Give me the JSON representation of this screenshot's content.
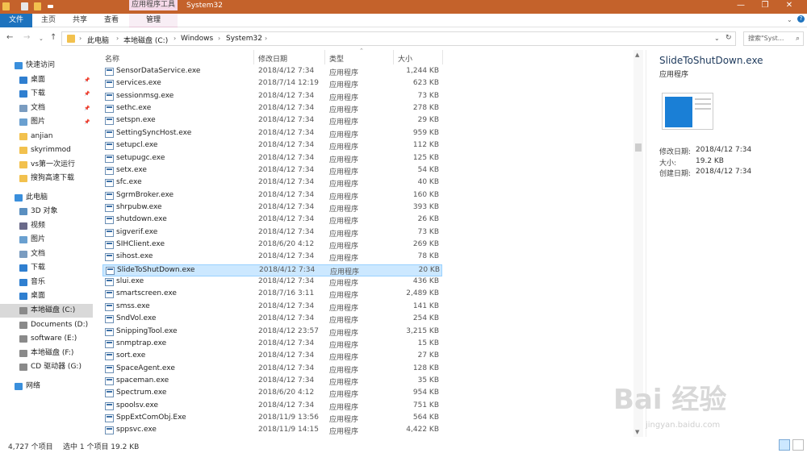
{
  "window": {
    "contextual_tab": "应用程序工具",
    "title": "System32"
  },
  "ribbon": {
    "tabs": [
      "文件",
      "主页",
      "共享",
      "查看",
      "管理"
    ]
  },
  "address": {
    "segments": [
      "此电脑",
      "本地磁盘 (C:)",
      "Windows",
      "System32"
    ],
    "search_placeholder": "搜索\"Syst..."
  },
  "sidebar": {
    "items": [
      {
        "label": "快速访问",
        "icon": "star-icon",
        "pinned": false
      },
      {
        "label": "桌面",
        "icon": "desktop-icon",
        "pinned": true
      },
      {
        "label": "下载",
        "icon": "download-icon",
        "pinned": true
      },
      {
        "label": "文档",
        "icon": "document-icon",
        "pinned": true
      },
      {
        "label": "图片",
        "icon": "picture-icon",
        "pinned": true
      },
      {
        "label": "anjian",
        "icon": "folder-icon",
        "pinned": false
      },
      {
        "label": "skyrimmod",
        "icon": "folder-icon",
        "pinned": false
      },
      {
        "label": "vs第一次运行",
        "icon": "folder-icon",
        "pinned": false
      },
      {
        "label": "搜狗高速下载",
        "icon": "folder-icon",
        "pinned": false
      },
      {
        "label": "此电脑",
        "icon": "computer-icon",
        "pinned": false
      },
      {
        "label": "3D 对象",
        "icon": "cube-icon",
        "pinned": false
      },
      {
        "label": "视频",
        "icon": "video-icon",
        "pinned": false
      },
      {
        "label": "图片",
        "icon": "picture-icon",
        "pinned": false
      },
      {
        "label": "文档",
        "icon": "document-icon",
        "pinned": false
      },
      {
        "label": "下载",
        "icon": "download-icon",
        "pinned": false
      },
      {
        "label": "音乐",
        "icon": "music-icon",
        "pinned": false
      },
      {
        "label": "桌面",
        "icon": "desktop-icon",
        "pinned": false
      },
      {
        "label": "本地磁盘 (C:)",
        "icon": "drive-icon",
        "pinned": false
      },
      {
        "label": "Documents (D:)",
        "icon": "drive-icon",
        "pinned": false
      },
      {
        "label": "software (E:)",
        "icon": "drive-icon",
        "pinned": false
      },
      {
        "label": "本地磁盘 (F:)",
        "icon": "drive-icon",
        "pinned": false
      },
      {
        "label": "CD 驱动器 (G:)",
        "icon": "cd-drive-icon",
        "pinned": false
      },
      {
        "label": "网络",
        "icon": "network-icon",
        "pinned": false
      }
    ],
    "pin_glyph": "📌"
  },
  "columns": [
    "名称",
    "修改日期",
    "类型",
    "大小"
  ],
  "files": [
    {
      "name": "SensorDataService.exe",
      "date": "2018/4/12 7:34",
      "type": "应用程序",
      "size": "1,244 KB"
    },
    {
      "name": "services.exe",
      "date": "2018/7/14 12:19",
      "type": "应用程序",
      "size": "623 KB"
    },
    {
      "name": "sessionmsg.exe",
      "date": "2018/4/12 7:34",
      "type": "应用程序",
      "size": "73 KB"
    },
    {
      "name": "sethc.exe",
      "date": "2018/4/12 7:34",
      "type": "应用程序",
      "size": "278 KB"
    },
    {
      "name": "setspn.exe",
      "date": "2018/4/12 7:34",
      "type": "应用程序",
      "size": "29 KB"
    },
    {
      "name": "SettingSyncHost.exe",
      "date": "2018/4/12 7:34",
      "type": "应用程序",
      "size": "959 KB"
    },
    {
      "name": "setupcl.exe",
      "date": "2018/4/12 7:34",
      "type": "应用程序",
      "size": "112 KB"
    },
    {
      "name": "setupugc.exe",
      "date": "2018/4/12 7:34",
      "type": "应用程序",
      "size": "125 KB"
    },
    {
      "name": "setx.exe",
      "date": "2018/4/12 7:34",
      "type": "应用程序",
      "size": "54 KB"
    },
    {
      "name": "sfc.exe",
      "date": "2018/4/12 7:34",
      "type": "应用程序",
      "size": "40 KB"
    },
    {
      "name": "SgrmBroker.exe",
      "date": "2018/4/12 7:34",
      "type": "应用程序",
      "size": "160 KB"
    },
    {
      "name": "shrpubw.exe",
      "date": "2018/4/12 7:34",
      "type": "应用程序",
      "size": "393 KB"
    },
    {
      "name": "shutdown.exe",
      "date": "2018/4/12 7:34",
      "type": "应用程序",
      "size": "26 KB"
    },
    {
      "name": "sigverif.exe",
      "date": "2018/4/12 7:34",
      "type": "应用程序",
      "size": "73 KB"
    },
    {
      "name": "SIHClient.exe",
      "date": "2018/6/20 4:12",
      "type": "应用程序",
      "size": "269 KB"
    },
    {
      "name": "sihost.exe",
      "date": "2018/4/12 7:34",
      "type": "应用程序",
      "size": "78 KB"
    },
    {
      "name": "SlideToShutDown.exe",
      "date": "2018/4/12 7:34",
      "type": "应用程序",
      "size": "20 KB",
      "selected": true
    },
    {
      "name": "slui.exe",
      "date": "2018/4/12 7:34",
      "type": "应用程序",
      "size": "436 KB"
    },
    {
      "name": "smartscreen.exe",
      "date": "2018/7/16 3:11",
      "type": "应用程序",
      "size": "2,489 KB"
    },
    {
      "name": "smss.exe",
      "date": "2018/4/12 7:34",
      "type": "应用程序",
      "size": "141 KB"
    },
    {
      "name": "SndVol.exe",
      "date": "2018/4/12 7:34",
      "type": "应用程序",
      "size": "254 KB"
    },
    {
      "name": "SnippingTool.exe",
      "date": "2018/4/12 23:57",
      "type": "应用程序",
      "size": "3,215 KB"
    },
    {
      "name": "snmptrap.exe",
      "date": "2018/4/12 7:34",
      "type": "应用程序",
      "size": "15 KB"
    },
    {
      "name": "sort.exe",
      "date": "2018/4/12 7:34",
      "type": "应用程序",
      "size": "27 KB"
    },
    {
      "name": "SpaceAgent.exe",
      "date": "2018/4/12 7:34",
      "type": "应用程序",
      "size": "128 KB"
    },
    {
      "name": "spaceman.exe",
      "date": "2018/4/12 7:34",
      "type": "应用程序",
      "size": "35 KB"
    },
    {
      "name": "Spectrum.exe",
      "date": "2018/6/20 4:12",
      "type": "应用程序",
      "size": "954 KB"
    },
    {
      "name": "spoolsv.exe",
      "date": "2018/4/12 7:34",
      "type": "应用程序",
      "size": "751 KB"
    },
    {
      "name": "SppExtComObj.Exe",
      "date": "2018/11/9 13:56",
      "type": "应用程序",
      "size": "564 KB"
    },
    {
      "name": "sppsvc.exe",
      "date": "2018/11/9 14:15",
      "type": "应用程序",
      "size": "4,422 KB"
    }
  ],
  "preview": {
    "name": "SlideToShutDown.exe",
    "type": "应用程序",
    "modified_label": "修改日期:",
    "modified_value": "2018/4/12 7:34",
    "size_label": "大小:",
    "size_value": "19.2 KB",
    "created_label": "创建日期:",
    "created_value": "2018/4/12 7:34"
  },
  "status": {
    "count": "4,727 个项目",
    "selection": "选中 1 个项目  19.2 KB"
  },
  "watermark": {
    "brand": "Bai 经验",
    "url": "jingyan.baidu.com"
  },
  "colors": {
    "titlebar": "#c4622b",
    "file_tab": "#1e73be",
    "selection": "#cce8ff"
  }
}
